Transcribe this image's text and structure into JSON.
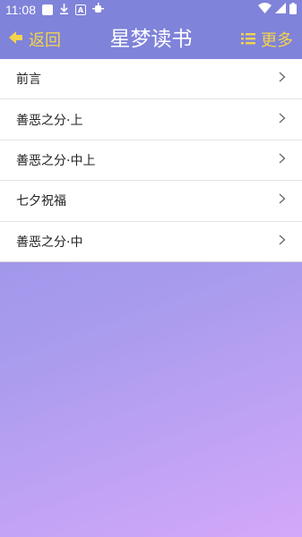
{
  "status_bar": {
    "time": "11:08",
    "left_icons": [
      "square-notification-icon",
      "download-icon",
      "a-icon",
      "bug-icon"
    ],
    "right_icons": [
      "wifi-icon",
      "signal-icon",
      "battery-icon"
    ]
  },
  "app_bar": {
    "back_label": "返回",
    "title": "星梦读书",
    "more_label": "更多",
    "background": "#7f83d9",
    "accent": "#f3d34c"
  },
  "chapters": [
    {
      "label": "前言"
    },
    {
      "label": "善恶之分·上"
    },
    {
      "label": "善恶之分·中上"
    },
    {
      "label": "七夕祝福"
    },
    {
      "label": "善恶之分·中"
    }
  ]
}
